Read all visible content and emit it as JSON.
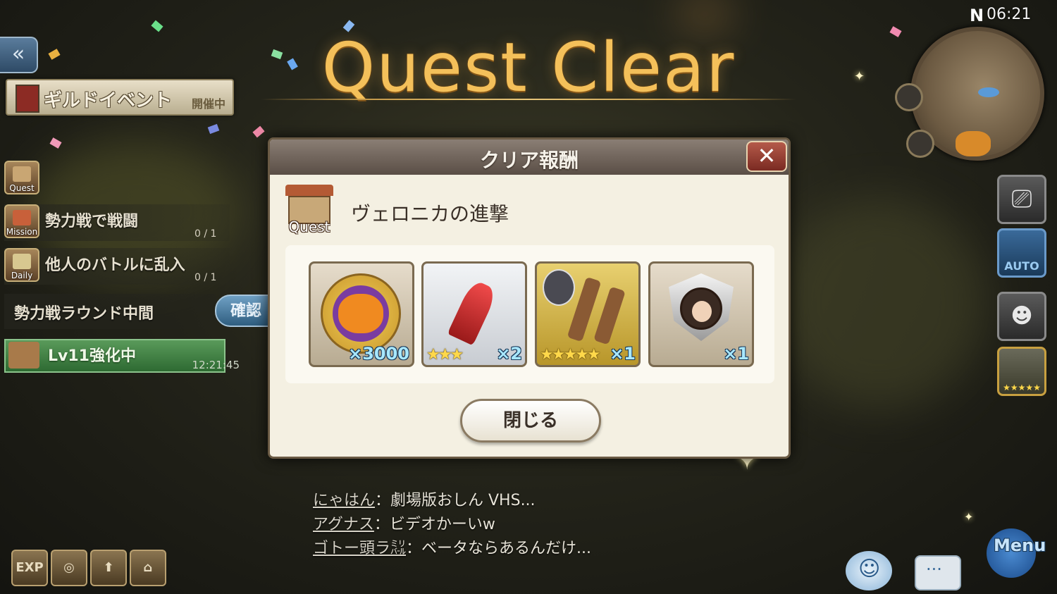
{
  "title": "Quest Clear",
  "status_bar": {
    "compass": "N",
    "time": "06:21"
  },
  "left_panel": {
    "guild_event": {
      "label": "ギルドイベント",
      "status": "開催中"
    },
    "quest_icon_label": "Quest",
    "missions": [
      {
        "icon_label": "Mission",
        "text": "勢力戦で戦闘",
        "progress": "0 / 1"
      },
      {
        "icon_label": "Daily",
        "text": "他人のバトルに乱入",
        "progress": "0 / 1"
      }
    ],
    "faction_round": {
      "text": "勢力戦ラウンド中間",
      "confirm_label": "確認"
    },
    "upgrade": {
      "text": "Lv11強化中",
      "timer": "12:21:45"
    }
  },
  "bottom_left_icons": [
    {
      "name": "exp",
      "label": "EXP"
    },
    {
      "name": "compass",
      "label": ""
    },
    {
      "name": "boots",
      "label": ""
    },
    {
      "name": "cage",
      "label": ""
    }
  ],
  "right_buttons": {
    "auto_label": "AUTO",
    "character_stars": "★★★★★"
  },
  "dialog": {
    "title": "クリア報酬",
    "quest_label": "Quest",
    "quest_name": "ヴェロニカの進撃",
    "rewards": [
      {
        "name": "pumpkin-medal",
        "stars": "",
        "count": "×3000"
      },
      {
        "name": "red-crystal",
        "stars": "★★★",
        "count": "×2"
      },
      {
        "name": "boots-equipment",
        "stars": "★★★★★",
        "count": "×1"
      },
      {
        "name": "character-emblem",
        "stars": "",
        "count": "×1"
      }
    ],
    "close_label": "閉じる"
  },
  "chat": [
    {
      "user": "にゃはん",
      "message": "：劇場版おしん VHS..."
    },
    {
      "user": "アグナス",
      "message": "：ビデオかーいw"
    },
    {
      "user": "ゴトー頭ラ㍊",
      "message": "：ベータならあるんだけ..."
    }
  ],
  "bottom_right": {
    "menu_label": "Menu"
  },
  "colors": {
    "title_gold": "#f4c05a",
    "dialog_bg": "#f4f0e2",
    "header_brown": "#6e625a",
    "count_blue": "#a8e8ff",
    "star_gold": "#ffd84a"
  }
}
